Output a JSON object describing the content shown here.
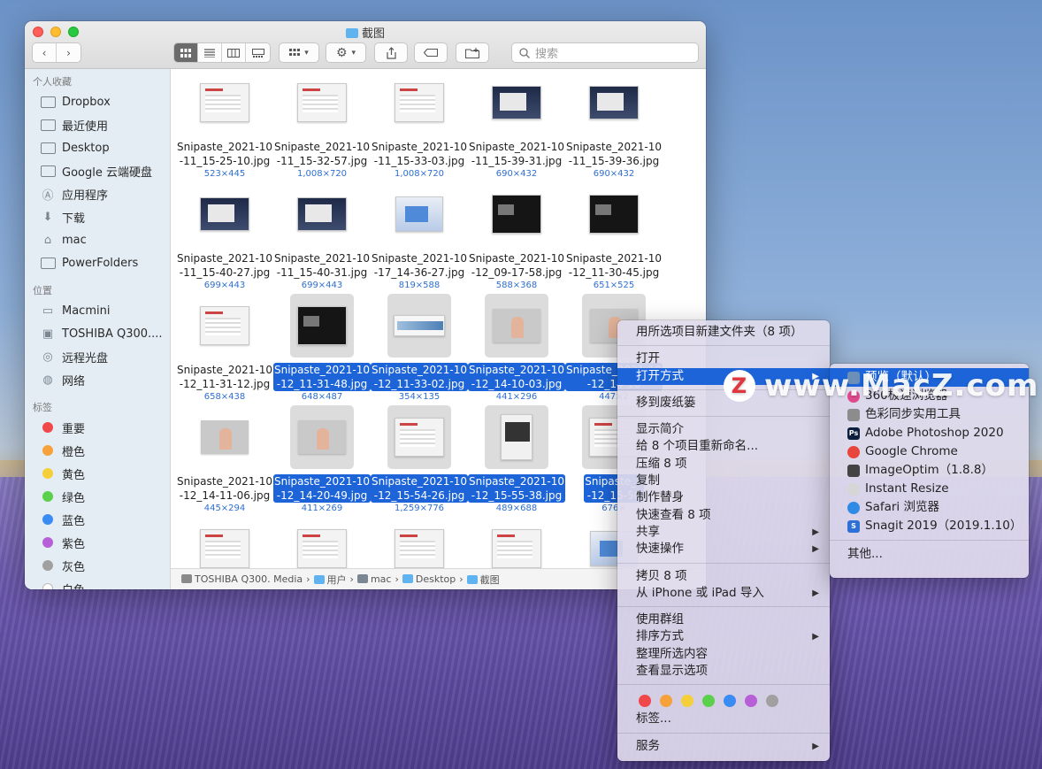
{
  "window": {
    "title": "截图",
    "search_placeholder": "搜索",
    "view_modes": [
      "icon-view",
      "list-view",
      "column-view",
      "gallery-view"
    ]
  },
  "sidebar": {
    "favorites_header": "个人收藏",
    "favorites": [
      {
        "label": "Dropbox",
        "icon": "folder-icon"
      },
      {
        "label": "最近使用",
        "icon": "folder-icon"
      },
      {
        "label": "Desktop",
        "icon": "folder-icon"
      },
      {
        "label": "Google 云端硬盘",
        "icon": "folder-icon"
      },
      {
        "label": "应用程序",
        "icon": "applications-icon"
      },
      {
        "label": "下载",
        "icon": "download-icon"
      },
      {
        "label": "mac",
        "icon": "home-icon"
      },
      {
        "label": "PowerFolders",
        "icon": "folder-icon"
      }
    ],
    "locations_header": "位置",
    "locations": [
      {
        "label": "Macmini",
        "icon": "computer-icon"
      },
      {
        "label": "TOSHIBA Q300....",
        "icon": "disk-icon"
      },
      {
        "label": "远程光盘",
        "icon": "optical-disc-icon"
      },
      {
        "label": "网络",
        "icon": "network-icon"
      }
    ],
    "tags_header": "标签",
    "tags": [
      {
        "label": "重要",
        "color": "#f0474a"
      },
      {
        "label": "橙色",
        "color": "#f6a13a"
      },
      {
        "label": "黄色",
        "color": "#f5cf3a"
      },
      {
        "label": "绿色",
        "color": "#5bd04c"
      },
      {
        "label": "蓝色",
        "color": "#3a8cf2"
      },
      {
        "label": "紫色",
        "color": "#b65fd6"
      },
      {
        "label": "灰色",
        "color": "#a0a0a0"
      },
      {
        "label": "白色",
        "color": "#ffffff"
      }
    ]
  },
  "files": [
    {
      "name1": "Snipaste_2021-10",
      "name2": "-11_15-25-10.jpg",
      "dim": "523×445",
      "selected": false,
      "theme": "light"
    },
    {
      "name1": "Snipaste_2021-10",
      "name2": "-11_15-32-57.jpg",
      "dim": "1,008×720",
      "selected": false,
      "theme": "light"
    },
    {
      "name1": "Snipaste_2021-10",
      "name2": "-11_15-33-03.jpg",
      "dim": "1,008×720",
      "selected": false,
      "theme": "light"
    },
    {
      "name1": "Snipaste_2021-10",
      "name2": "-11_15-39-31.jpg",
      "dim": "690×432",
      "selected": false,
      "theme": "desk"
    },
    {
      "name1": "Snipaste_2021-10",
      "name2": "-11_15-39-36.jpg",
      "dim": "690×432",
      "selected": false,
      "theme": "desk"
    },
    {
      "name1": "Snipaste_2021-10",
      "name2": "-11_15-40-27.jpg",
      "dim": "699×443",
      "selected": false,
      "theme": "desk2"
    },
    {
      "name1": "Snipaste_2021-10",
      "name2": "-11_15-40-31.jpg",
      "dim": "699×443",
      "selected": false,
      "theme": "desk2"
    },
    {
      "name1": "Snipaste_2021-10",
      "name2": "-17_14-36-27.jpg",
      "dim": "819×588",
      "selected": false,
      "theme": "blue"
    },
    {
      "name1": "Snipaste_2021-10",
      "name2": "-12_09-17-58.jpg",
      "dim": "588×368",
      "selected": false,
      "theme": "dark"
    },
    {
      "name1": "Snipaste_2021-10",
      "name2": "-12_11-30-45.jpg",
      "dim": "651×525",
      "selected": false,
      "theme": "dark"
    },
    {
      "name1": "Snipaste_2021-10",
      "name2": "-12_11-31-12.jpg",
      "dim": "658×438",
      "selected": false,
      "theme": "light"
    },
    {
      "name1": "Snipaste_2021-10",
      "name2": "-12_11-31-48.jpg",
      "dim": "648×487",
      "selected": true,
      "theme": "dark"
    },
    {
      "name1": "Snipaste_2021-10",
      "name2": "-12_11-33-02.jpg",
      "dim": "354×135",
      "selected": true,
      "theme": "wide"
    },
    {
      "name1": "Snipaste_2021-10",
      "name2": "-12_14-10-03.jpg",
      "dim": "441×296",
      "selected": true,
      "theme": "hand"
    },
    {
      "name1": "Snipaste_2021-10",
      "name2": "-12_14-10",
      "dim": "447×2",
      "selected": true,
      "theme": "hand"
    },
    {
      "name1": "Snipaste_2021-10",
      "name2": "-12_14-11-06.jpg",
      "dim": "445×294",
      "selected": false,
      "theme": "hand"
    },
    {
      "name1": "Snipaste_2021-10",
      "name2": "-12_14-20-49.jpg",
      "dim": "411×269",
      "selected": true,
      "theme": "hand"
    },
    {
      "name1": "Snipaste_2021-10",
      "name2": "-12_15-54-26.jpg",
      "dim": "1,259×776",
      "selected": true,
      "theme": "light"
    },
    {
      "name1": "Snipaste_2021-10",
      "name2": "-12_15-55-38.jpg",
      "dim": "489×688",
      "selected": true,
      "theme": "tall"
    },
    {
      "name1": "Snipaste_2",
      "name2": "-12_15-56",
      "dim": "676×",
      "selected": true,
      "theme": "light"
    },
    {
      "name1": "",
      "name2": "",
      "dim": "",
      "selected": false,
      "theme": "light"
    },
    {
      "name1": "",
      "name2": "",
      "dim": "",
      "selected": false,
      "theme": "light"
    },
    {
      "name1": "",
      "name2": "",
      "dim": "",
      "selected": false,
      "theme": "light"
    },
    {
      "name1": "",
      "name2": "",
      "dim": "",
      "selected": false,
      "theme": "light"
    },
    {
      "name1": "",
      "name2": "",
      "dim": "",
      "selected": false,
      "theme": "blue"
    }
  ],
  "pathbar": [
    "TOSHIBA Q300. Media",
    "用户",
    "mac",
    "Desktop",
    "截图"
  ],
  "context_menu": {
    "new_folder": "用所选项目新建文件夹（8 项）",
    "open": "打开",
    "open_with": "打开方式",
    "trash": "移到废纸篓",
    "get_info": "显示简介",
    "rename": "给 8 个项目重新命名...",
    "compress": "压缩 8 项",
    "duplicate": "复制",
    "alias": "制作替身",
    "quicklook": "快速查看 8 项",
    "share": "共享",
    "quick_actions": "快速操作",
    "copy": "拷贝 8 项",
    "import": "从 iPhone 或 iPad 导入",
    "use_groups": "使用群组",
    "sort_by": "排序方式",
    "cleanup": "整理所选内容",
    "view_options": "查看显示选项",
    "tag_colors": [
      "#f0474a",
      "#f6a13a",
      "#f5cf3a",
      "#5bd04c",
      "#3a8cf2",
      "#b65fd6",
      "#a0a0a0"
    ],
    "tags": "标签...",
    "services": "服务"
  },
  "open_with_menu": {
    "items": [
      {
        "label": "预览（默认）",
        "icon": "preview-icon",
        "color": "#6c8fb8",
        "glyph": ""
      },
      {
        "label": "360极速浏览器",
        "icon": "browser-360-icon",
        "color": "#e04a8c",
        "glyph": ""
      },
      {
        "label": "色彩同步实用工具",
        "icon": "colorsync-icon",
        "color": "#8c8c8c",
        "glyph": ""
      },
      {
        "label": "Adobe Photoshop 2020",
        "icon": "photoshop-icon",
        "color": "#0c1f3d",
        "glyph": "Ps"
      },
      {
        "label": "Google Chrome",
        "icon": "chrome-icon",
        "color": "#e8453c",
        "glyph": ""
      },
      {
        "label": "ImageOptim（1.8.8）",
        "icon": "imageoptim-icon",
        "color": "#444444",
        "glyph": ""
      },
      {
        "label": "Instant Resize",
        "icon": "instant-resize-icon",
        "color": "#d6d6d6",
        "glyph": ""
      },
      {
        "label": "Safari 浏览器",
        "icon": "safari-icon",
        "color": "#2f8ae5",
        "glyph": ""
      },
      {
        "label": "Snagit 2019（2019.1.10）",
        "icon": "snagit-icon",
        "color": "#2f6fd8",
        "glyph": "S"
      }
    ],
    "other": "其他..."
  },
  "watermark": {
    "logo": "Z",
    "text": "www.MacZ.com"
  }
}
